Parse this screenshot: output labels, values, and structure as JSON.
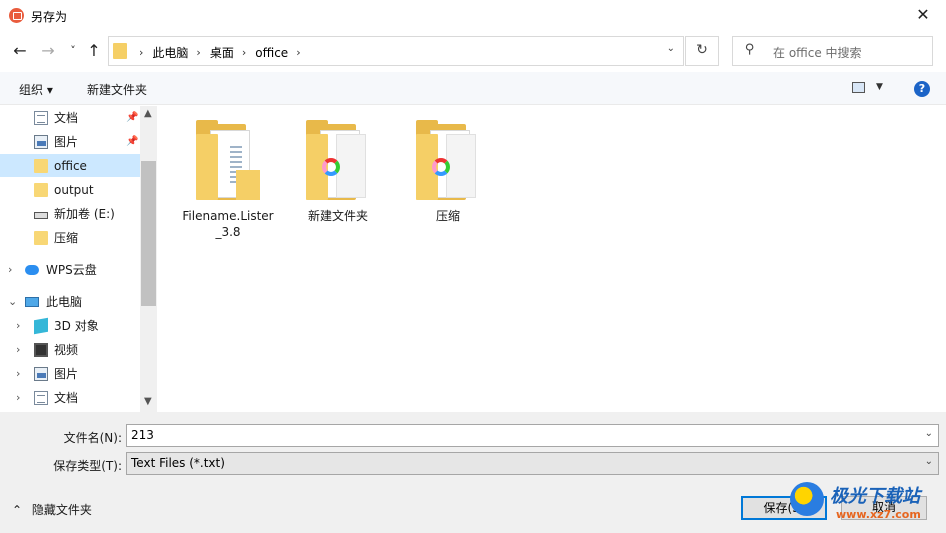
{
  "window": {
    "title": "另存为",
    "close_glyph": "✕"
  },
  "nav": {
    "back_glyph": "←",
    "forward_glyph": "→",
    "recent_glyph": "˅",
    "up_glyph": "↑",
    "breadcrumbs": [
      "此电脑",
      "桌面",
      "office"
    ],
    "crumb_sep": "›",
    "dropdown_glyph": "⌄",
    "refresh_glyph": "↻",
    "search_icon_glyph": "⚲",
    "search_placeholder": "在 office 中搜索"
  },
  "toolbar": {
    "organize": "组织 ▾",
    "new_folder": "新建文件夹",
    "view_drop_glyph": "▼",
    "help": "?"
  },
  "sidebar": {
    "items": [
      {
        "label": "文档",
        "icon": "document-icon",
        "pinned": true
      },
      {
        "label": "图片",
        "icon": "picture-icon",
        "pinned": true
      },
      {
        "label": "office",
        "icon": "folder-icon",
        "selected": true
      },
      {
        "label": "output",
        "icon": "folder-icon"
      },
      {
        "label": "新加卷 (E:)",
        "icon": "drive-icon"
      },
      {
        "label": "压缩",
        "icon": "folder-icon"
      },
      {
        "label": "WPS云盘",
        "icon": "cloud-icon",
        "expandable": true
      },
      {
        "label": "此电脑",
        "icon": "computer-icon",
        "expanded": true
      },
      {
        "label": "3D 对象",
        "icon": "3d-objects-icon",
        "expandable": true
      },
      {
        "label": "视频",
        "icon": "video-icon",
        "expandable": true
      },
      {
        "label": "图片",
        "icon": "picture-icon",
        "expandable": true
      },
      {
        "label": "文档",
        "icon": "document-icon",
        "expandable": true
      }
    ],
    "pin_glyph": "📌",
    "expand_glyph": "›",
    "collapse_glyph": "⌄",
    "scroll_up_glyph": "▲",
    "scroll_down_glyph": "▼"
  },
  "files": [
    {
      "name": "Filename.Lister_3.8",
      "type": "folder-doc"
    },
    {
      "name": "新建文件夹",
      "type": "folder-swirl"
    },
    {
      "name": "压缩",
      "type": "folder-swirl"
    }
  ],
  "form": {
    "filename_label": "文件名(N):",
    "filename_value": "213",
    "filetype_label": "保存类型(T):",
    "filetype_value": "Text Files (*.txt)",
    "dropdown_glyph": "⌄"
  },
  "footer": {
    "hide_folders": "隐藏文件夹",
    "hide_folders_glyph": "⌃",
    "save": "保存(S)",
    "cancel": "取消"
  },
  "watermark": {
    "title": "极光下载站",
    "url": "www.xz7.com"
  }
}
